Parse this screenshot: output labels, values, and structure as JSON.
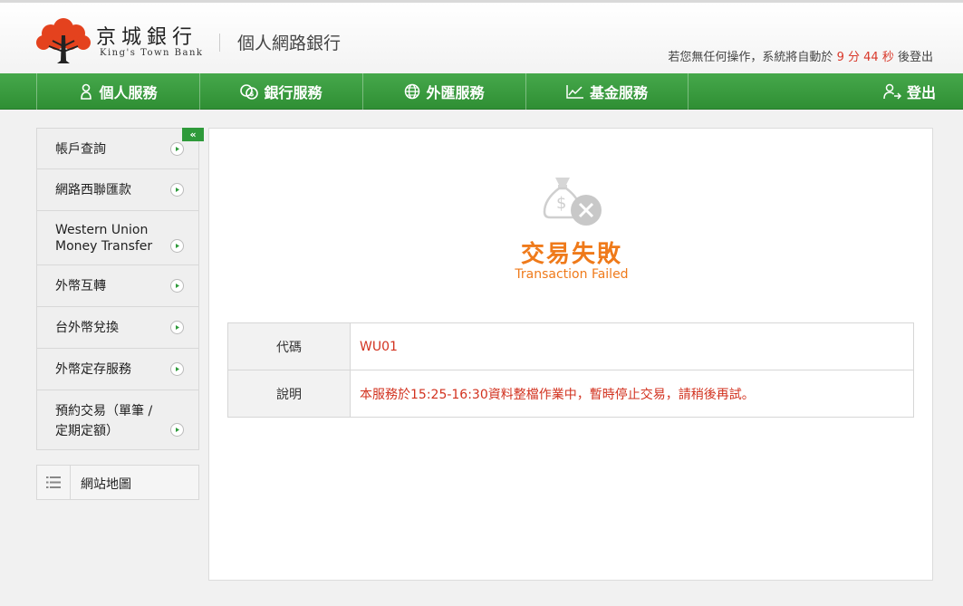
{
  "header": {
    "logo_cn": "京城銀行",
    "logo_en": "King's Town Bank",
    "site_title": "個人網路銀行",
    "timeout_prefix": "若您無任何操作，系統將自動於",
    "timeout_minutes": "9",
    "timeout_min_unit": "分",
    "timeout_seconds": "44",
    "timeout_sec_unit": "秒",
    "timeout_suffix": "後登出"
  },
  "nav": {
    "items": [
      {
        "label": "個人服務",
        "icon": "person-icon"
      },
      {
        "label": "銀行服務",
        "icon": "coins-icon"
      },
      {
        "label": "外匯服務",
        "icon": "globe-icon"
      },
      {
        "label": "基金服務",
        "icon": "chart-icon"
      }
    ],
    "logout": "登出"
  },
  "sidebar": {
    "collapse_glyph": "«",
    "items": [
      {
        "label": "帳戶查詢"
      },
      {
        "label": "網路西聯匯款"
      },
      {
        "label_line1": "Western Union",
        "label_line2": "Money Transfer"
      },
      {
        "label": "外幣互轉"
      },
      {
        "label": "台外幣兌換"
      },
      {
        "label": "外幣定存服務"
      },
      {
        "label_line1": "預約交易（單筆 /",
        "label_line2": "定期定額）"
      }
    ],
    "sitemap": "網站地圖"
  },
  "result": {
    "title": "交易失敗",
    "subtitle": "Transaction Failed",
    "rows": [
      {
        "label": "代碼",
        "value": "WU01"
      },
      {
        "label": "說明",
        "value": "本服務於15:25-16:30資料整檔作業中，暫時停止交易，請稍後再試。"
      }
    ]
  },
  "colors": {
    "nav_green": "#3a9d3f",
    "accent_orange": "#ef7a1a",
    "error_red": "#d2321f",
    "logo_red": "#e4421e"
  }
}
